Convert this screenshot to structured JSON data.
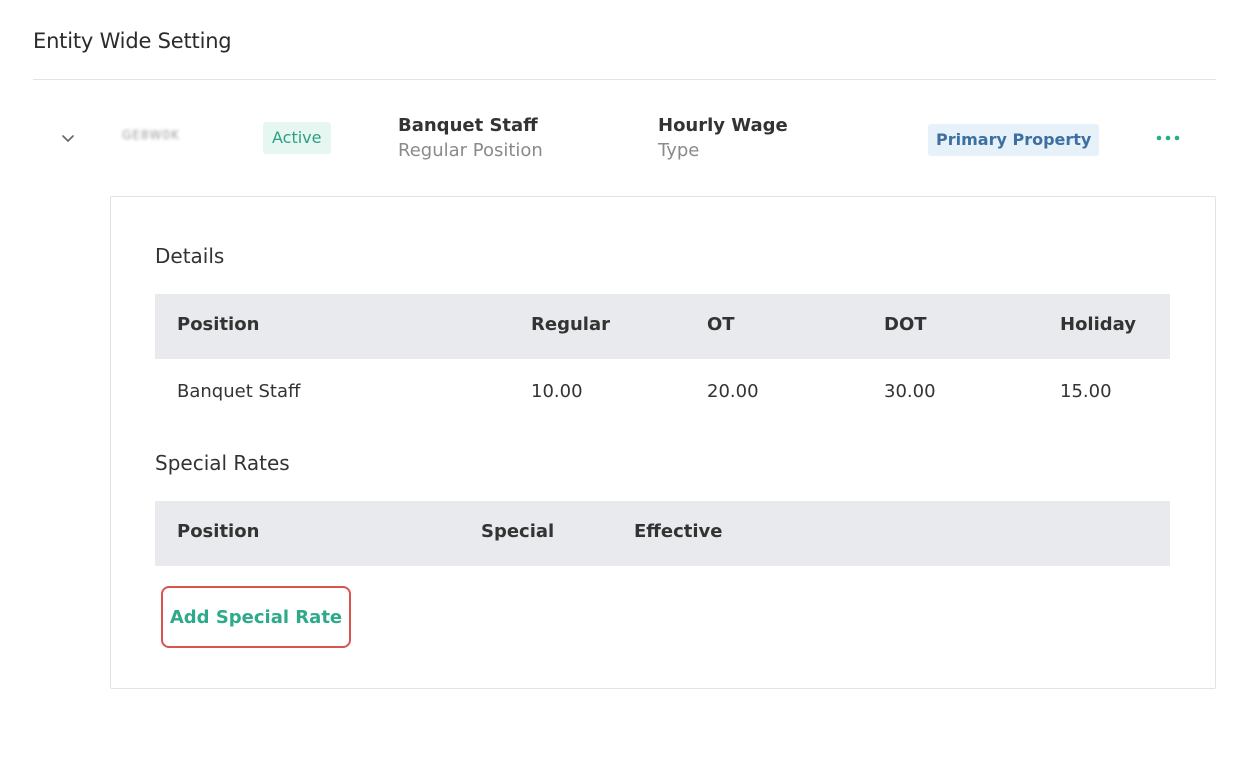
{
  "page": {
    "section_title": "Entity Wide Setting"
  },
  "summary": {
    "id_text": "GE8W0K",
    "status": "Active",
    "position_name": "Banquet Staff",
    "position_sub": "Regular Position",
    "wage_name": "Hourly Wage",
    "wage_sub": "Type",
    "property_badge": "Primary Property",
    "expand_icon": "chevron-down-icon",
    "more_icon": "more-horizontal-icon"
  },
  "details": {
    "heading": "Details",
    "columns": [
      "Position",
      "Regular",
      "OT",
      "DOT",
      "Holiday"
    ],
    "rows": [
      [
        "Banquet Staff",
        "10.00",
        "20.00",
        "30.00",
        "15.00"
      ]
    ]
  },
  "special_rates": {
    "heading": "Special Rates",
    "columns": [
      "Position",
      "Special",
      "Effective"
    ],
    "rows": [],
    "add_button_label": "Add Special Rate"
  },
  "colors": {
    "accent_green": "#2eaa8a",
    "status_bg": "#e6f6f1",
    "property_text": "#3d6fa0",
    "property_bg": "#e6f1fa",
    "highlight_border": "#d9534f",
    "table_header_bg": "#e9eaed"
  }
}
